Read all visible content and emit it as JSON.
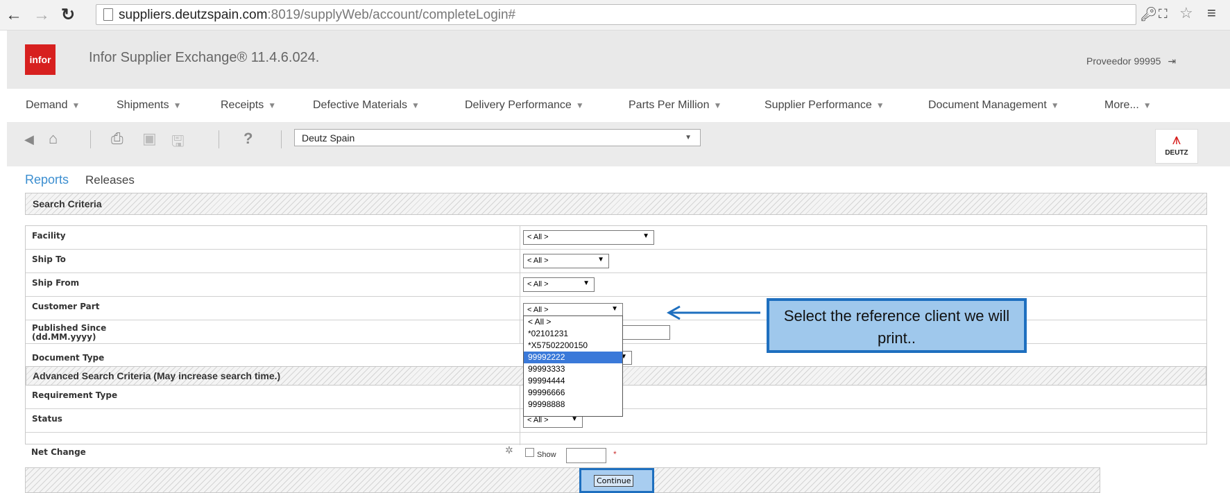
{
  "browser": {
    "url_host": "suppliers.deutzspain.com",
    "url_rest": ":8019/supplyWeb/account/completeLogin#",
    "back_icon": "arrow-left",
    "forward_icon": "arrow-right",
    "reload_icon": "reload",
    "menu_icon": "hamburger"
  },
  "app": {
    "logo_text": "infor",
    "title": "Infor Supplier Exchange® 11.4.6.024.",
    "user_label": "Proveedor 99995",
    "brand_color": "#d7201f"
  },
  "menu": {
    "items": [
      "Demand",
      "Shipments",
      "Receipts",
      "Defective Materials",
      "Delivery Performance",
      "Parts Per Million",
      "Supplier Performance",
      "Document Management",
      "More..."
    ]
  },
  "toolbar": {
    "company_select": "Deutz Spain",
    "deutz_logo_text": "DEUTZ"
  },
  "tabs": {
    "reports": "Reports",
    "releases": "Releases"
  },
  "search": {
    "header": "Search Criteria",
    "rows": {
      "facility": {
        "label": "Facility",
        "value": "< All >"
      },
      "ship_to": {
        "label": "Ship To",
        "value": "< All >"
      },
      "ship_from": {
        "label": "Ship From",
        "value": "< All >"
      },
      "customer_part": {
        "label": "Customer Part",
        "value": "< All >"
      },
      "published_since": {
        "label_line1": "Published Since",
        "label_line2": "(dd.MM.yyyy)"
      },
      "document_type": {
        "label": "Document Type"
      }
    },
    "advanced_header": "Advanced Search Criteria (May increase search time.)",
    "advanced_rows": {
      "requirement_type": {
        "label": "Requirement Type"
      },
      "status": {
        "label": "Status",
        "value": "< All >"
      },
      "net_change": {
        "label": "Net Change",
        "checkbox_label": "Show",
        "required_mark": "*"
      }
    },
    "customer_part_options": [
      "< All >",
      "*02101231",
      "*X57502200150",
      "99992222",
      "99993333",
      "99994444",
      "99996666",
      "99998888"
    ],
    "highlighted_option": "99992222",
    "continue_label": "Continue"
  },
  "annotation": {
    "callout_text": "Select the reference client we will print.."
  }
}
